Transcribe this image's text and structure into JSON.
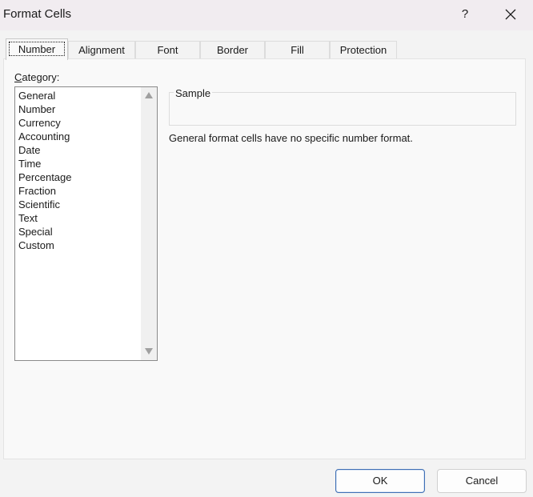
{
  "window": {
    "title": "Format Cells",
    "help_label": "?"
  },
  "tabs": [
    {
      "label": "Number",
      "active": true
    },
    {
      "label": "Alignment"
    },
    {
      "label": "Font"
    },
    {
      "label": "Border"
    },
    {
      "label": "Fill"
    },
    {
      "label": "Protection"
    }
  ],
  "number_tab": {
    "category_label_accel": "C",
    "category_label_rest": "ategory:",
    "categories": [
      "General",
      "Number",
      "Currency",
      "Accounting",
      "Date",
      "Time",
      "Percentage",
      "Fraction",
      "Scientific",
      "Text",
      "Special",
      "Custom"
    ],
    "sample_label": "Sample",
    "sample_value": "",
    "description": "General format cells have no specific number format."
  },
  "buttons": {
    "ok": "OK",
    "cancel": "Cancel"
  },
  "icons": {
    "close": "close-icon",
    "scroll_up": "scroll-up-arrow-icon",
    "scroll_down": "scroll-down-arrow-icon"
  }
}
